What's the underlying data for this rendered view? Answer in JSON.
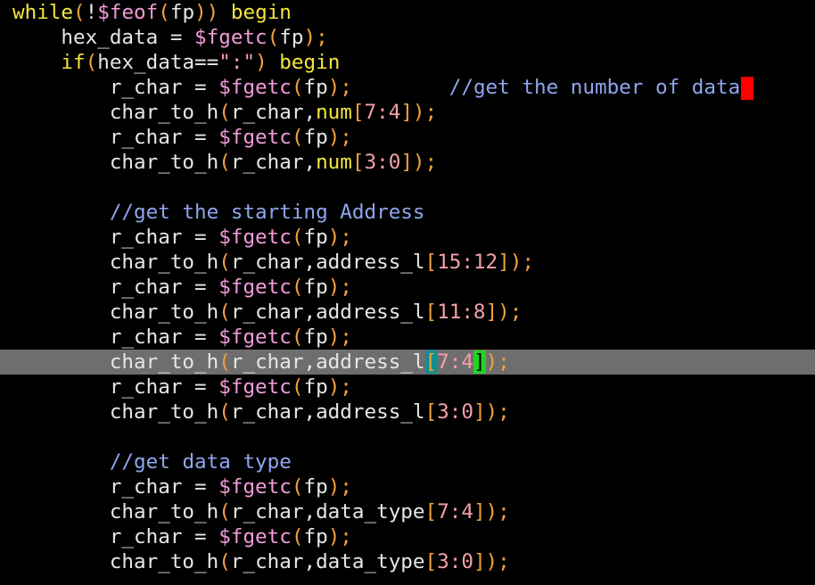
{
  "editor": {
    "cursor_line": 14,
    "lines": [
      {
        "tokens": [
          {
            "t": "while",
            "c": "kw"
          },
          {
            "t": "(",
            "c": "par"
          },
          {
            "t": "!",
            "c": "id"
          },
          {
            "t": "$feof",
            "c": "sys"
          },
          {
            "t": "(",
            "c": "par"
          },
          {
            "t": "fp",
            "c": "id"
          },
          {
            "t": "))",
            "c": "par"
          },
          {
            "t": " begin",
            "c": "kw"
          }
        ]
      },
      {
        "tokens": [
          {
            "t": "    hex_data = ",
            "c": "id"
          },
          {
            "t": "$fgetc",
            "c": "sys"
          },
          {
            "t": "(",
            "c": "par"
          },
          {
            "t": "fp",
            "c": "id"
          },
          {
            "t": ");",
            "c": "par"
          }
        ]
      },
      {
        "tokens": [
          {
            "t": "    if",
            "c": "kw"
          },
          {
            "t": "(",
            "c": "par"
          },
          {
            "t": "hex_data==",
            "c": "id"
          },
          {
            "t": "\":\"",
            "c": "str"
          },
          {
            "t": ")",
            "c": "par"
          },
          {
            "t": " begin",
            "c": "kw"
          }
        ]
      },
      {
        "cursor": true,
        "tokens": [
          {
            "t": "        r_char = ",
            "c": "id"
          },
          {
            "t": "$fgetc",
            "c": "sys"
          },
          {
            "t": "(",
            "c": "par"
          },
          {
            "t": "fp",
            "c": "id"
          },
          {
            "t": ");",
            "c": "par"
          },
          {
            "t": "        ",
            "c": "id"
          },
          {
            "t": "//get the number of data",
            "c": "cmt"
          }
        ]
      },
      {
        "tokens": [
          {
            "t": "        char_to_h",
            "c": "id"
          },
          {
            "t": "(",
            "c": "par"
          },
          {
            "t": "r_char,",
            "c": "id"
          },
          {
            "t": "num",
            "c": "kw"
          },
          {
            "t": "[",
            "c": "par"
          },
          {
            "t": "7:4",
            "c": "num"
          },
          {
            "t": "]);",
            "c": "par"
          }
        ]
      },
      {
        "tokens": [
          {
            "t": "        r_char = ",
            "c": "id"
          },
          {
            "t": "$fgetc",
            "c": "sys"
          },
          {
            "t": "(",
            "c": "par"
          },
          {
            "t": "fp",
            "c": "id"
          },
          {
            "t": ");",
            "c": "par"
          }
        ]
      },
      {
        "tokens": [
          {
            "t": "        char_to_h",
            "c": "id"
          },
          {
            "t": "(",
            "c": "par"
          },
          {
            "t": "r_char,",
            "c": "id"
          },
          {
            "t": "num",
            "c": "kw"
          },
          {
            "t": "[",
            "c": "par"
          },
          {
            "t": "3:0",
            "c": "num"
          },
          {
            "t": "]);",
            "c": "par"
          }
        ]
      },
      {
        "tokens": []
      },
      {
        "tokens": [
          {
            "t": "        ",
            "c": "id"
          },
          {
            "t": "//get the starting Address",
            "c": "cmt"
          }
        ]
      },
      {
        "tokens": [
          {
            "t": "        r_char = ",
            "c": "id"
          },
          {
            "t": "$fgetc",
            "c": "sys"
          },
          {
            "t": "(",
            "c": "par"
          },
          {
            "t": "fp",
            "c": "id"
          },
          {
            "t": ");",
            "c": "par"
          }
        ]
      },
      {
        "tokens": [
          {
            "t": "        char_to_h",
            "c": "id"
          },
          {
            "t": "(",
            "c": "par"
          },
          {
            "t": "r_char,address_l",
            "c": "id"
          },
          {
            "t": "[",
            "c": "par"
          },
          {
            "t": "15:12",
            "c": "num"
          },
          {
            "t": "]);",
            "c": "par"
          }
        ]
      },
      {
        "tokens": [
          {
            "t": "        r_char = ",
            "c": "id"
          },
          {
            "t": "$fgetc",
            "c": "sys"
          },
          {
            "t": "(",
            "c": "par"
          },
          {
            "t": "fp",
            "c": "id"
          },
          {
            "t": ");",
            "c": "par"
          }
        ]
      },
      {
        "tokens": [
          {
            "t": "        char_to_h",
            "c": "id"
          },
          {
            "t": "(",
            "c": "par"
          },
          {
            "t": "r_char,address_l",
            "c": "id"
          },
          {
            "t": "[",
            "c": "par"
          },
          {
            "t": "11:8",
            "c": "num"
          },
          {
            "t": "]);",
            "c": "par"
          }
        ]
      },
      {
        "tokens": [
          {
            "t": "        r_char = ",
            "c": "id"
          },
          {
            "t": "$fgetc",
            "c": "sys"
          },
          {
            "t": "(",
            "c": "par"
          },
          {
            "t": "fp",
            "c": "id"
          },
          {
            "t": ");",
            "c": "par"
          }
        ]
      },
      {
        "tokens": [
          {
            "t": "        char_to_h",
            "c": "id"
          },
          {
            "t": "(",
            "c": "par"
          },
          {
            "t": "r_char,address_l",
            "c": "id"
          },
          {
            "t": "[",
            "c": "par mbr"
          },
          {
            "t": "7:4",
            "c": "num"
          },
          {
            "t": "]",
            "c": "mbr2"
          },
          {
            "t": ");",
            "c": "par"
          }
        ]
      },
      {
        "tokens": [
          {
            "t": "        r_char = ",
            "c": "id"
          },
          {
            "t": "$fgetc",
            "c": "sys"
          },
          {
            "t": "(",
            "c": "par"
          },
          {
            "t": "fp",
            "c": "id"
          },
          {
            "t": ");",
            "c": "par"
          }
        ]
      },
      {
        "tokens": [
          {
            "t": "        char_to_h",
            "c": "id"
          },
          {
            "t": "(",
            "c": "par"
          },
          {
            "t": "r_char,address_l",
            "c": "id"
          },
          {
            "t": "[",
            "c": "par"
          },
          {
            "t": "3:0",
            "c": "num"
          },
          {
            "t": "]);",
            "c": "par"
          }
        ]
      },
      {
        "tokens": []
      },
      {
        "tokens": [
          {
            "t": "        ",
            "c": "id"
          },
          {
            "t": "//get data type",
            "c": "cmt"
          }
        ]
      },
      {
        "tokens": [
          {
            "t": "        r_char = ",
            "c": "id"
          },
          {
            "t": "$fgetc",
            "c": "sys"
          },
          {
            "t": "(",
            "c": "par"
          },
          {
            "t": "fp",
            "c": "id"
          },
          {
            "t": ");",
            "c": "par"
          }
        ]
      },
      {
        "tokens": [
          {
            "t": "        char_to_h",
            "c": "id"
          },
          {
            "t": "(",
            "c": "par"
          },
          {
            "t": "r_char,data_type",
            "c": "id"
          },
          {
            "t": "[",
            "c": "par"
          },
          {
            "t": "7:4",
            "c": "num"
          },
          {
            "t": "]);",
            "c": "par"
          }
        ]
      },
      {
        "tokens": [
          {
            "t": "        r_char = ",
            "c": "id"
          },
          {
            "t": "$fgetc",
            "c": "sys"
          },
          {
            "t": "(",
            "c": "par"
          },
          {
            "t": "fp",
            "c": "id"
          },
          {
            "t": ");",
            "c": "par"
          }
        ]
      },
      {
        "tokens": [
          {
            "t": "        char_to_h",
            "c": "id"
          },
          {
            "t": "(",
            "c": "par"
          },
          {
            "t": "r_char,data_type",
            "c": "id"
          },
          {
            "t": "[",
            "c": "par"
          },
          {
            "t": "3:0",
            "c": "num"
          },
          {
            "t": "]);",
            "c": "par"
          }
        ]
      }
    ]
  }
}
